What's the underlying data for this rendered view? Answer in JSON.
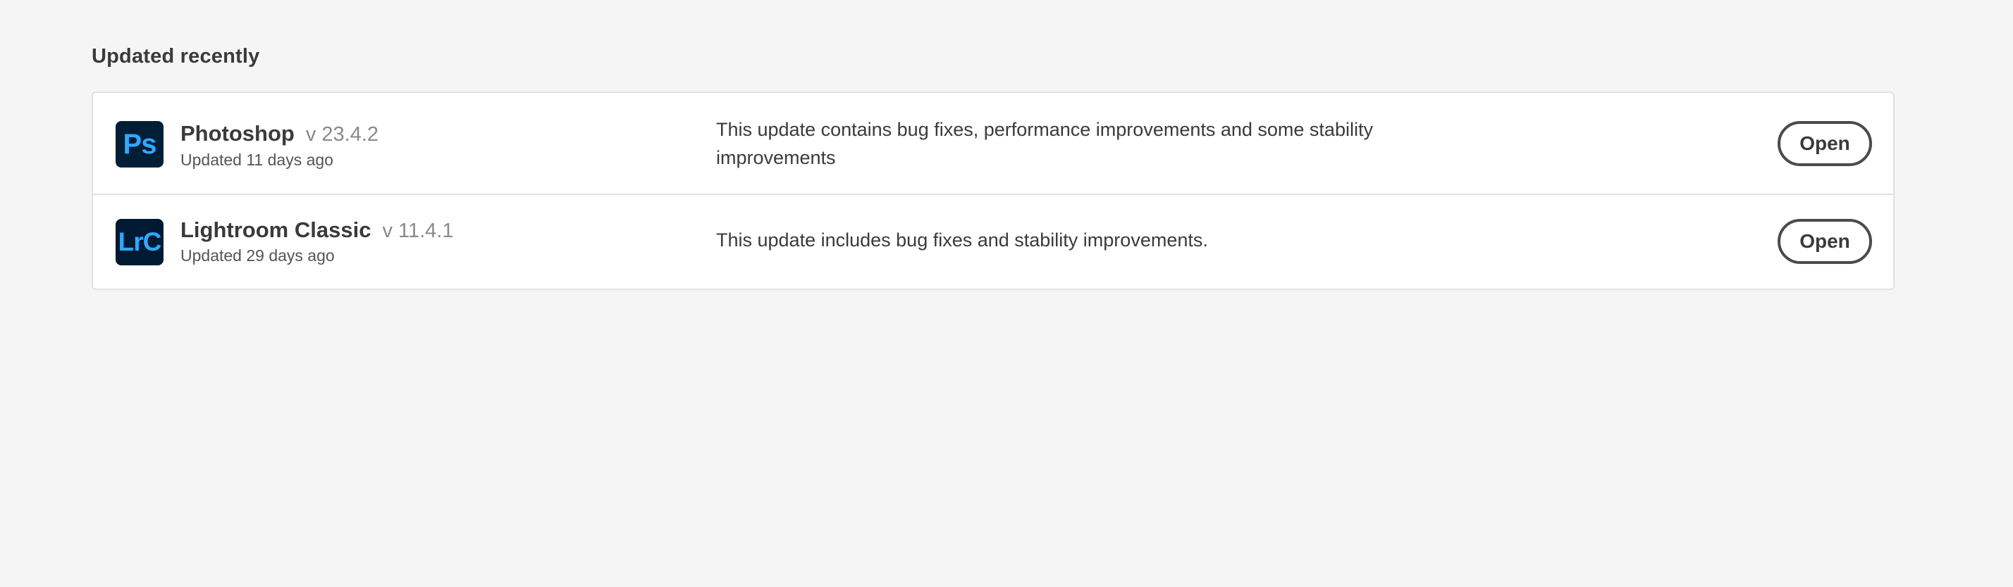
{
  "section": {
    "title": "Updated recently"
  },
  "apps": [
    {
      "icon_label": "Ps",
      "icon_name": "photoshop-app-icon",
      "name": "Photoshop",
      "version": "v 23.4.2",
      "updated": "Updated 11 days ago",
      "description": "This update contains bug fixes, performance improvements and some stability improvements",
      "action_label": "Open"
    },
    {
      "icon_label": "LrC",
      "icon_name": "lightroom-classic-app-icon",
      "name": "Lightroom Classic",
      "version": "v 11.4.1",
      "updated": "Updated 29 days ago",
      "description": "This update includes bug fixes and stability improvements.",
      "action_label": "Open"
    }
  ],
  "colors": {
    "background": "#f5f5f5",
    "card": "#ffffff",
    "icon_bg": "#001e36",
    "icon_text": "#31a8ff",
    "button_border": "#4b4b4b"
  }
}
